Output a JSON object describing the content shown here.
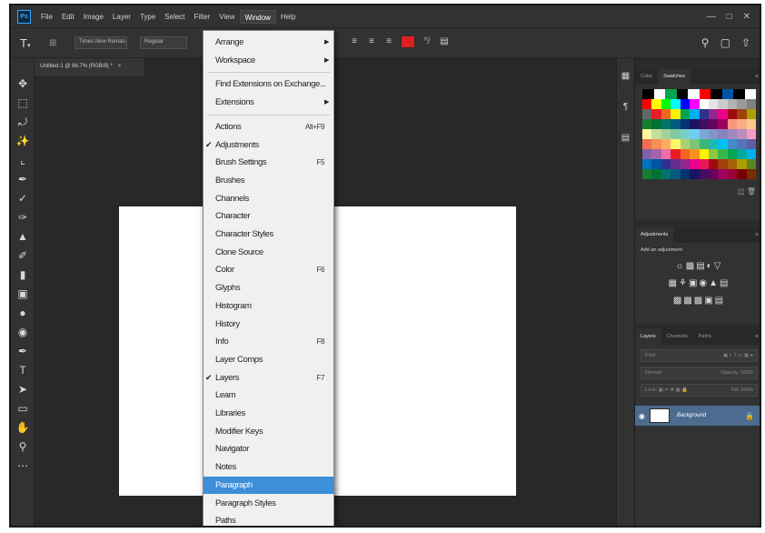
{
  "app": {
    "logo_text": "Ps",
    "menus": [
      "File",
      "Edit",
      "Image",
      "Layer",
      "Type",
      "Select",
      "Filter",
      "View",
      "Window",
      "Help"
    ],
    "active_menu": "Window",
    "window_controls": [
      "—",
      "□",
      "✕"
    ]
  },
  "options_bar": {
    "font_family": "Times New Roman",
    "font_style": "Regular",
    "text_color": "#e01f1f"
  },
  "document": {
    "tab_title": "Untitled-1 @ 66.7% (RGB/8) *",
    "close": "×"
  },
  "window_menu": {
    "items": [
      {
        "label": "Arrange",
        "submenu": true
      },
      {
        "label": "Workspace",
        "submenu": true
      },
      {
        "separator": true
      },
      {
        "label": "Find Extensions on Exchange..."
      },
      {
        "label": "Extensions",
        "submenu": true
      },
      {
        "separator": true
      },
      {
        "label": "Actions",
        "shortcut": "Alt+F9"
      },
      {
        "label": "Adjustments",
        "checked": true
      },
      {
        "label": "Brush Settings",
        "shortcut": "F5"
      },
      {
        "label": "Brushes"
      },
      {
        "label": "Channels"
      },
      {
        "label": "Character"
      },
      {
        "label": "Character Styles"
      },
      {
        "label": "Clone Source"
      },
      {
        "label": "Color",
        "shortcut": "F6"
      },
      {
        "label": "Glyphs"
      },
      {
        "label": "Histogram"
      },
      {
        "label": "History"
      },
      {
        "label": "Info",
        "shortcut": "F8"
      },
      {
        "label": "Layer Comps"
      },
      {
        "label": "Layers",
        "shortcut": "F7",
        "checked": true
      },
      {
        "label": "Learn"
      },
      {
        "label": "Libraries"
      },
      {
        "label": "Modifier Keys"
      },
      {
        "label": "Navigator"
      },
      {
        "label": "Notes"
      },
      {
        "label": "Paragraph",
        "highlighted": true
      },
      {
        "label": "Paragraph Styles"
      },
      {
        "label": "Paths"
      }
    ]
  },
  "swatches_panel": {
    "tabs": [
      "Color",
      "Swatches"
    ],
    "active_tab": "Swatches"
  },
  "adjustments_panel": {
    "tab": "Adjustments",
    "hint": "Add an adjustment"
  },
  "layers_panel": {
    "tabs": [
      "Layers",
      "Channels",
      "Paths"
    ],
    "active_tab": "Layers",
    "filter_placeholder": "Kind",
    "blend_mode": "Normal",
    "opacity_label": "Opacity:",
    "opacity_value": "100%",
    "lock_label": "Lock:",
    "fill_label": "Fill:",
    "fill_value": "100%",
    "layer": {
      "name": "Background",
      "visible": true,
      "locked": true
    }
  }
}
